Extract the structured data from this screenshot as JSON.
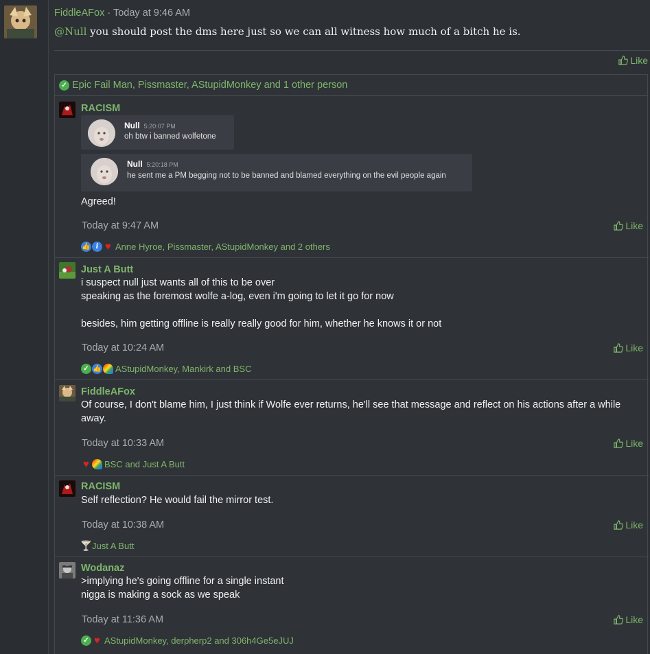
{
  "main_post": {
    "username": "FiddleAFox",
    "timestamp": " · Today at 9:46 AM",
    "mention": "@Null",
    "body": " you should post the dms here just so we can all witness how much of a bitch he is.",
    "like_label": "Like",
    "reactions_summary": "Epic Fail Man, Pissmaster, AStupidMonkey and 1 other person"
  },
  "replies": [
    {
      "username": "RACISM",
      "embeds": [
        {
          "name": "Null",
          "time": "5:20:07 PM",
          "message": "oh btw i banned wolfetone"
        },
        {
          "name": "Null",
          "time": "5:20:18 PM",
          "message": "he sent me a PM begging not to be banned and blamed everything on the evil people again"
        }
      ],
      "text": "Agreed!",
      "timestamp": "Today at 9:47 AM",
      "like_label": "Like",
      "reactions": "Anne Hyroe, Pissmaster, AStupidMonkey and 2 others"
    },
    {
      "username": "Just A Butt",
      "lines": [
        "i suspect null just wants all of this to be over",
        "speaking as the foremost wolfe a-log, even i'm going to let it go for now",
        "",
        "besides, him getting offline is really really good for him, whether he knows it or not"
      ],
      "timestamp": "Today at 10:24 AM",
      "like_label": "Like",
      "reactions": "AStupidMonkey, Mankirk and BSC"
    },
    {
      "username": "FiddleAFox",
      "lines": [
        "Of course, I don't blame him, I just think if Wolfe ever returns, he'll see that message and reflect on his actions after a while",
        "away."
      ],
      "timestamp": "Today at 10:33 AM",
      "like_label": "Like",
      "reactions": "BSC and Just A Butt"
    },
    {
      "username": "RACISM",
      "lines": [
        "Self reflection? He would fail the mirror test."
      ],
      "timestamp": "Today at 10:38 AM",
      "like_label": "Like",
      "reactions": "Just A Butt"
    },
    {
      "username": "Wodanaz",
      "lines": [
        ">implying he's going offline for a single instant",
        "nigga is making a sock as we speak"
      ],
      "timestamp": "Today at 11:36 AM",
      "like_label": "Like",
      "reactions": "AStupidMonkey, derpherp2 and 306h4Ge5eJUJ"
    }
  ],
  "colors": {
    "accent": "#7fb56a",
    "background": "#2d3136",
    "panel": "#2f3338",
    "border": "#454a50"
  }
}
